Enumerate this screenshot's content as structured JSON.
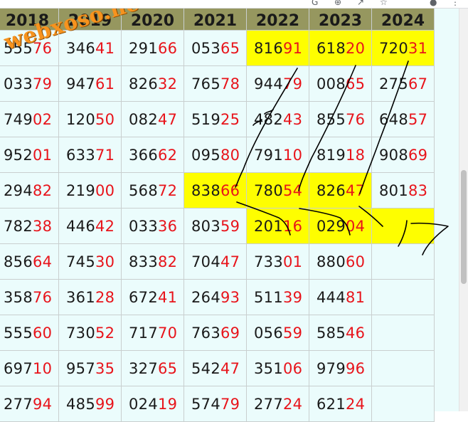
{
  "browser": {
    "toolbar_icons": [
      "google-icon",
      "zoom-icon",
      "share-icon",
      "bookmark-star-icon",
      "profile-icon"
    ]
  },
  "watermark": "webxoso.net",
  "table": {
    "headers": [
      "2018",
      "2019",
      "2020",
      "2021",
      "2022",
      "2023",
      "2024"
    ],
    "rows": [
      [
        {
          "h": "555",
          "t": "76"
        },
        {
          "h": "346",
          "t": "41"
        },
        {
          "h": "291",
          "t": "66"
        },
        {
          "h": "053",
          "t": "65"
        },
        {
          "h": "816",
          "t": "91",
          "hl": true
        },
        {
          "h": "618",
          "t": "20",
          "hl": true
        },
        {
          "h": "720",
          "t": "31",
          "hl": true
        }
      ],
      [
        {
          "h": "033",
          "t": "79"
        },
        {
          "h": "947",
          "t": "61"
        },
        {
          "h": "826",
          "t": "32"
        },
        {
          "h": "765",
          "t": "78"
        },
        {
          "h": "944",
          "t": "79"
        },
        {
          "h": "008",
          "t": "65"
        },
        {
          "h": "275",
          "t": "67"
        }
      ],
      [
        {
          "h": "749",
          "t": "02"
        },
        {
          "h": "120",
          "t": "50"
        },
        {
          "h": "082",
          "t": "47"
        },
        {
          "h": "519",
          "t": "25"
        },
        {
          "h": "482",
          "t": "43"
        },
        {
          "h": "855",
          "t": "76"
        },
        {
          "h": "648",
          "t": "57"
        }
      ],
      [
        {
          "h": "952",
          "t": "01"
        },
        {
          "h": "633",
          "t": "71"
        },
        {
          "h": "366",
          "t": "62"
        },
        {
          "h": "095",
          "t": "80"
        },
        {
          "h": "791",
          "t": "10"
        },
        {
          "h": "819",
          "t": "18"
        },
        {
          "h": "908",
          "t": "69"
        }
      ],
      [
        {
          "h": "294",
          "t": "82"
        },
        {
          "h": "219",
          "t": "00"
        },
        {
          "h": "568",
          "t": "72"
        },
        {
          "h": "838",
          "t": "66",
          "hl": true
        },
        {
          "h": "780",
          "t": "54",
          "hl": true
        },
        {
          "h": "826",
          "t": "47",
          "hl": true
        },
        {
          "h": "801",
          "t": "83"
        }
      ],
      [
        {
          "h": "782",
          "t": "38"
        },
        {
          "h": "446",
          "t": "42"
        },
        {
          "h": "033",
          "t": "36"
        },
        {
          "h": "803",
          "t": "59"
        },
        {
          "h": "201",
          "t": "16",
          "hl": true
        },
        {
          "h": "029",
          "t": "04",
          "hl": true
        },
        {
          "h": "",
          "t": "",
          "hl": true
        }
      ],
      [
        {
          "h": "856",
          "t": "64"
        },
        {
          "h": "745",
          "t": "30"
        },
        {
          "h": "833",
          "t": "82"
        },
        {
          "h": "704",
          "t": "47"
        },
        {
          "h": "733",
          "t": "01"
        },
        {
          "h": "880",
          "t": "60"
        },
        {
          "h": "",
          "t": ""
        }
      ],
      [
        {
          "h": "358",
          "t": "76"
        },
        {
          "h": "361",
          "t": "28"
        },
        {
          "h": "672",
          "t": "41"
        },
        {
          "h": "264",
          "t": "93"
        },
        {
          "h": "511",
          "t": "39"
        },
        {
          "h": "444",
          "t": "81"
        },
        {
          "h": "",
          "t": ""
        }
      ],
      [
        {
          "h": "555",
          "t": "60"
        },
        {
          "h": "730",
          "t": "52"
        },
        {
          "h": "717",
          "t": "70"
        },
        {
          "h": "763",
          "t": "69"
        },
        {
          "h": "056",
          "t": "59"
        },
        {
          "h": "585",
          "t": "46"
        },
        {
          "h": "",
          "t": ""
        }
      ],
      [
        {
          "h": "697",
          "t": "10"
        },
        {
          "h": "957",
          "t": "35"
        },
        {
          "h": "327",
          "t": "65"
        },
        {
          "h": "542",
          "t": "47"
        },
        {
          "h": "351",
          "t": "06"
        },
        {
          "h": "979",
          "t": "96"
        },
        {
          "h": "",
          "t": ""
        }
      ],
      [
        {
          "h": "277",
          "t": "94"
        },
        {
          "h": "485",
          "t": "99"
        },
        {
          "h": "024",
          "t": "19"
        },
        {
          "h": "574",
          "t": "79"
        },
        {
          "h": "277",
          "t": "24"
        },
        {
          "h": "621",
          "t": "24"
        },
        {
          "h": "",
          "t": ""
        }
      ]
    ]
  },
  "annotation": {
    "handwritten_text": "17",
    "ink_color": "#000000"
  },
  "colors": {
    "header_bg": "#96975f",
    "cell_bg": "#ebfcfc",
    "highlight": "#fefe00",
    "tail_digits": "#e8141b"
  }
}
